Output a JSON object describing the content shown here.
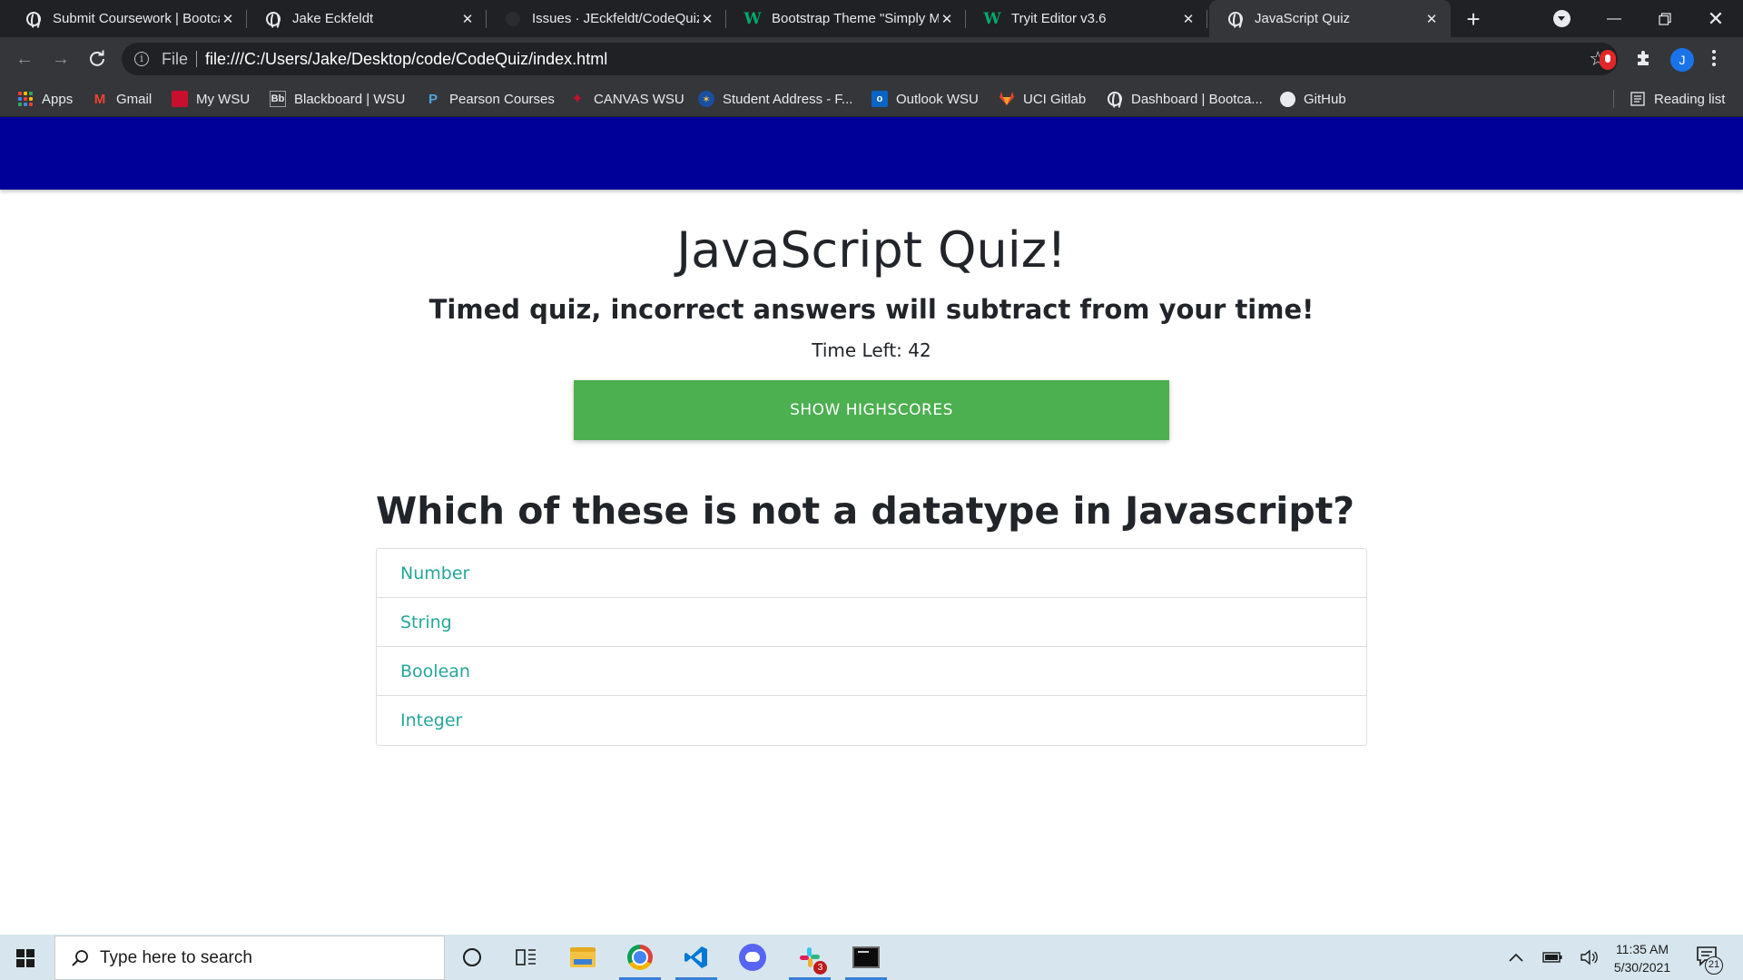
{
  "browser": {
    "tabs": [
      {
        "title": "Submit Coursework | Bootca",
        "icon": "globe-icon",
        "active": false
      },
      {
        "title": "Jake Eckfeldt",
        "icon": "globe-icon",
        "active": false
      },
      {
        "title": "Issues · JEckfeldt/CodeQuiz",
        "icon": "github-icon",
        "active": false
      },
      {
        "title": "Bootstrap Theme \"Simply M",
        "icon": "w3schools-icon",
        "active": false
      },
      {
        "title": "Tryit Editor v3.6",
        "icon": "w3schools-icon",
        "active": false
      },
      {
        "title": "JavaScript Quiz",
        "icon": "globe-icon",
        "active": true
      }
    ],
    "address_bar": {
      "scheme_label": "File",
      "url": "file:///C:/Users/Jake/Desktop/code/CodeQuiz/index.html"
    },
    "profile_initial": "J",
    "bookmarks": [
      {
        "label": "Apps",
        "icon": "apps-grid-icon"
      },
      {
        "label": "Gmail",
        "icon": "gmail-icon"
      },
      {
        "label": "My WSU",
        "icon": "mywsu-icon"
      },
      {
        "label": "Blackboard | WSU",
        "icon": "blackboard-icon"
      },
      {
        "label": "Pearson Courses",
        "icon": "pearson-icon"
      },
      {
        "label": "CANVAS WSU",
        "icon": "canvas-icon"
      },
      {
        "label": "Student Address - F...",
        "icon": "student-address-icon"
      },
      {
        "label": "Outlook WSU",
        "icon": "outlook-icon"
      },
      {
        "label": "UCI Gitlab",
        "icon": "gitlab-icon"
      },
      {
        "label": "Dashboard | Bootca...",
        "icon": "globe-icon"
      },
      {
        "label": "GitHub",
        "icon": "github-icon"
      }
    ],
    "reading_list_label": "Reading list"
  },
  "page": {
    "navbar_color": "#000099",
    "title": "JavaScript Quiz!",
    "subtitle": "Timed quiz, incorrect answers will subtract from your time!",
    "timer_label": "Time Left:",
    "timer_value": 42,
    "timer_text": "Time Left: 42",
    "highscores_button": "SHOW HIGHSCORES",
    "highscores_button_color": "#4caf50",
    "question": "Which of these is not a datatype in Javascript?",
    "answers": [
      "Number",
      "String",
      "Boolean",
      "Integer"
    ],
    "answer_color": "#26a69a"
  },
  "taskbar": {
    "search_placeholder": "Type here to search",
    "apps": [
      "cortana-icon",
      "task-view-icon",
      "file-explorer-icon",
      "chrome-icon",
      "vscode-icon",
      "discord-icon",
      "slack-icon",
      "terminal-icon"
    ],
    "slack_badge": "3",
    "time": "11:35 AM",
    "date": "5/30/2021",
    "notification_count": "21"
  }
}
